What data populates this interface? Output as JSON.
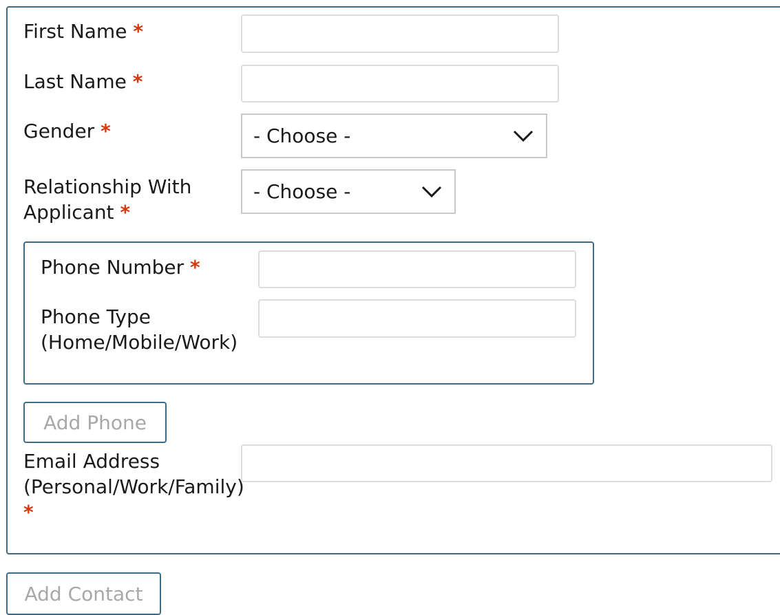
{
  "form": {
    "required_marker": "*",
    "first_name": {
      "label": "First Name",
      "value": "",
      "placeholder": ""
    },
    "last_name": {
      "label": "Last Name",
      "value": "",
      "placeholder": ""
    },
    "gender": {
      "label": "Gender",
      "selected": "- Choose -"
    },
    "relationship": {
      "label_line1": "Relationship With",
      "label_line2": "Applicant",
      "selected": "- Choose -"
    },
    "phone": {
      "number_label": "Phone Number",
      "number_value": "",
      "type_label_line1": "Phone Type",
      "type_label_line2": "(Home/Mobile/Work)",
      "type_value": "",
      "add_button": "Add Phone"
    },
    "email": {
      "label_line1": "Email Address",
      "label_line2": "(Personal/Work/Family)",
      "value": ""
    },
    "add_contact_button": "Add Contact"
  },
  "colors": {
    "border_accent": "#3e6a85",
    "required": "#d4380d",
    "button_text_disabled": "#a8a8a8"
  },
  "icons": {
    "select_indicator": "chevron-down-icon"
  }
}
